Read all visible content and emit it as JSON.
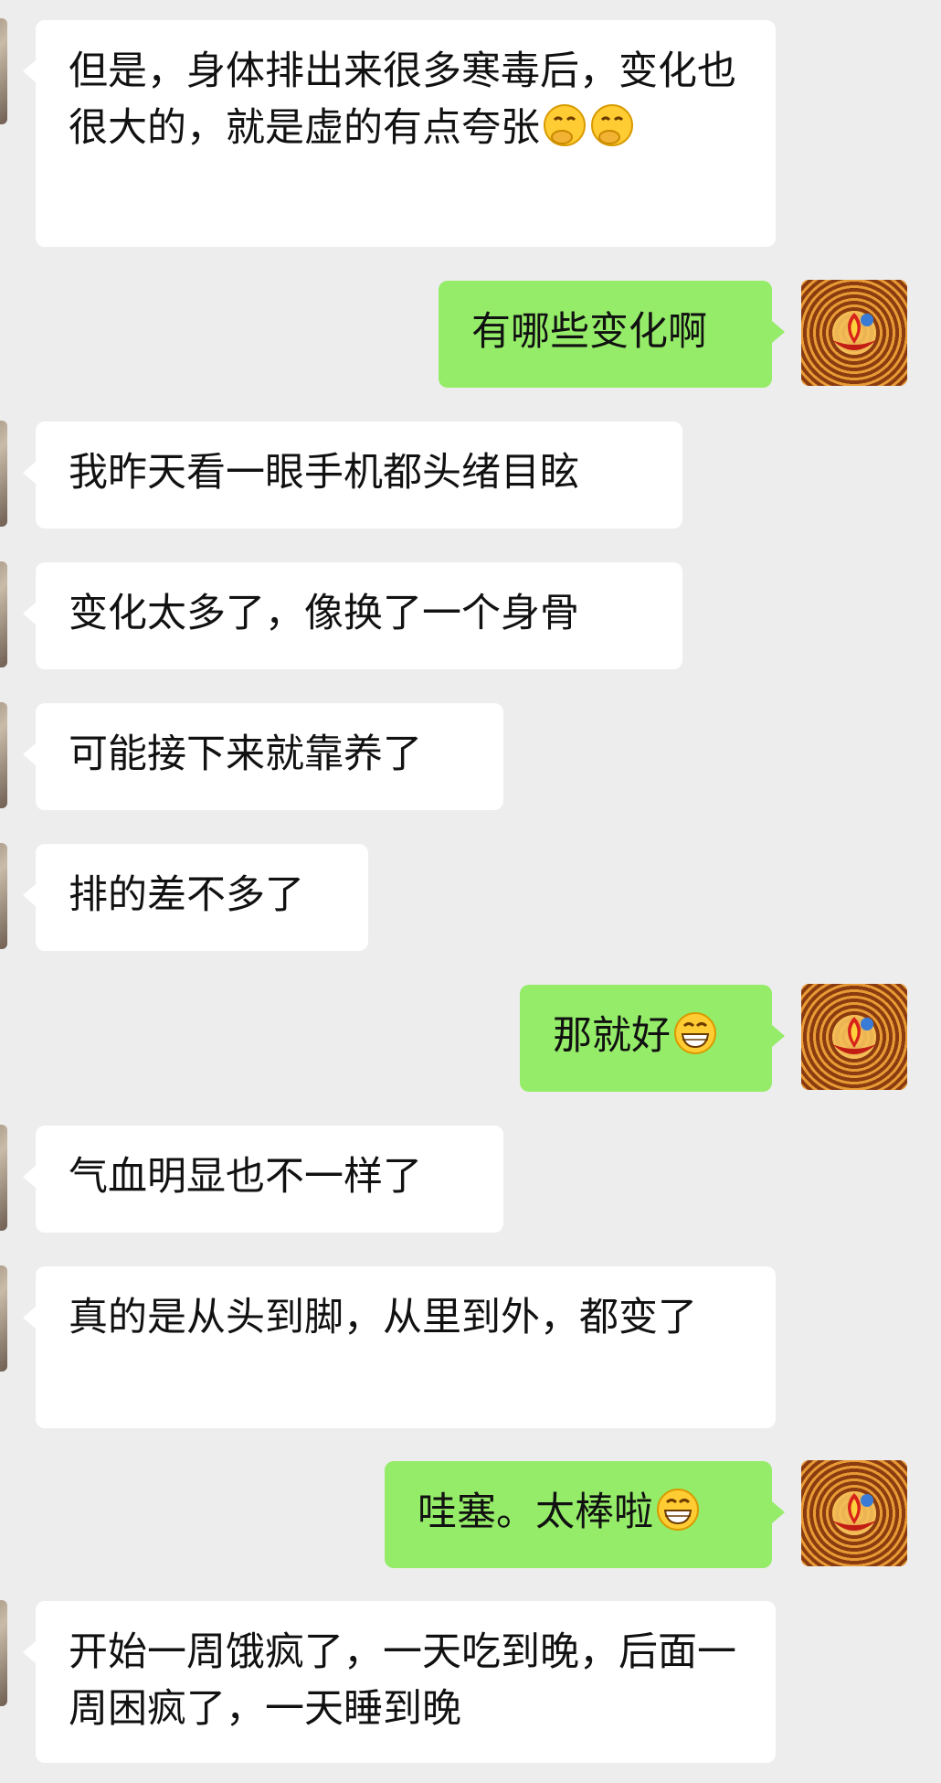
{
  "messages": [
    {
      "side": "in",
      "text": "但是，身体排出来很多寒毒后，变化也很大的，就是虚的有点夸张",
      "emoji_names": [
        "face-with-hand-over-mouth-emoji",
        "face-with-hand-over-mouth-emoji"
      ]
    },
    {
      "side": "out",
      "text": "有哪些变化啊",
      "emoji_names": []
    },
    {
      "side": "in",
      "text": "我昨天看一眼手机都头绪目眩",
      "emoji_names": []
    },
    {
      "side": "in",
      "text": "变化太多了，像换了一个身骨",
      "emoji_names": []
    },
    {
      "side": "in",
      "text": "可能接下来就靠养了",
      "emoji_names": []
    },
    {
      "side": "in",
      "text": "排的差不多了",
      "emoji_names": []
    },
    {
      "side": "out",
      "text": "那就好",
      "emoji_names": [
        "grinning-face-emoji"
      ]
    },
    {
      "side": "in",
      "text": "气血明显也不一样了",
      "emoji_names": []
    },
    {
      "side": "in",
      "text": "真的是从头到脚，从里到外，都变了",
      "emoji_names": []
    },
    {
      "side": "out",
      "text": "哇塞。太棒啦",
      "emoji_names": [
        "grinning-face-emoji"
      ]
    },
    {
      "side": "in",
      "text": "开始一周饿疯了，一天吃到晚，后面一周困疯了，一天睡到晚",
      "emoji_names": []
    }
  ],
  "colors": {
    "background": "#ededed",
    "incoming_bubble": "#ffffff",
    "outgoing_bubble": "#95ec69",
    "text": "#111111"
  },
  "icons": {
    "own_avatar": "lotus-flame-avatar-icon",
    "contact_avatar": "contact-avatar-icon"
  }
}
